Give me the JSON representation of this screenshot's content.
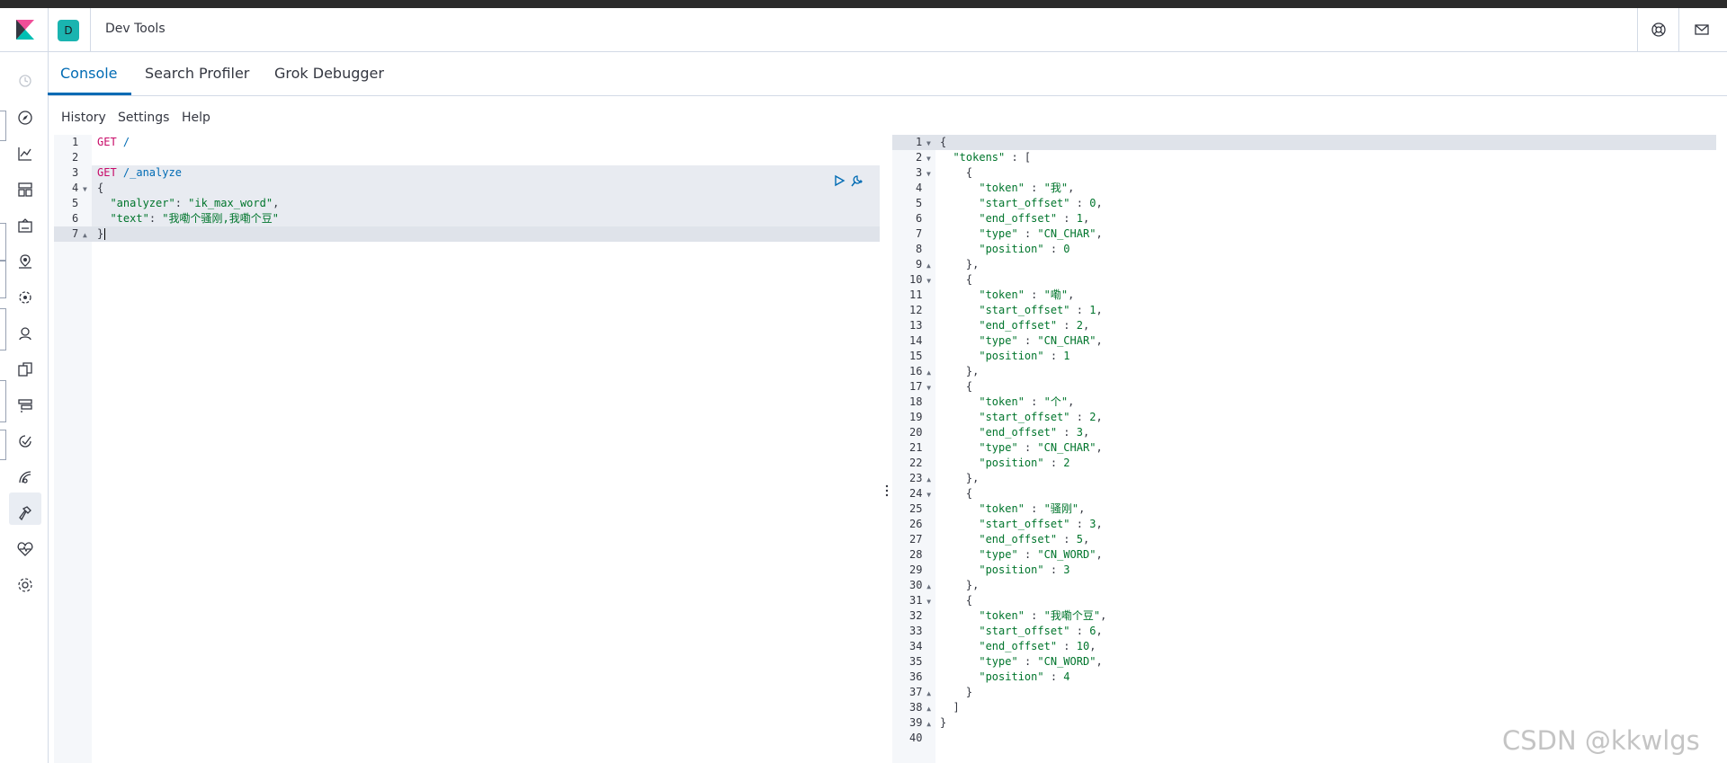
{
  "header": {
    "space_initial": "D",
    "title": "Dev Tools",
    "icons": [
      "help-icon",
      "mail-icon"
    ]
  },
  "tabs": [
    {
      "label": "Console",
      "active": true
    },
    {
      "label": "Search Profiler",
      "active": false
    },
    {
      "label": "Grok Debugger",
      "active": false
    }
  ],
  "console_menu": [
    "History",
    "Settings",
    "Help"
  ],
  "sidenav_icons": [
    "recent-icon",
    "discover-icon",
    "visualize-icon",
    "dashboard-icon",
    "canvas-icon",
    "maps-icon",
    "ml-icon",
    "graph-icon",
    "apm-icon",
    "uptime-icon",
    "metrics-icon",
    "siem-icon",
    "dev-tools-icon",
    "monitoring-icon",
    "management-icon"
  ],
  "request_editor": {
    "lines": [
      "GET /",
      "",
      "GET /_analyze",
      "{",
      "  \"analyzer\": \"ik_max_word\",",
      "  \"text\": \"我嘞个骚刚,我嘞个豆\"",
      "}"
    ]
  },
  "response_editor": {
    "lines": [
      "{",
      "  \"tokens\" : [",
      "    {",
      "      \"token\" : \"我\",",
      "      \"start_offset\" : 0,",
      "      \"end_offset\" : 1,",
      "      \"type\" : \"CN_CHAR\",",
      "      \"position\" : 0",
      "    },",
      "    {",
      "      \"token\" : \"嘞\",",
      "      \"start_offset\" : 1,",
      "      \"end_offset\" : 2,",
      "      \"type\" : \"CN_CHAR\",",
      "      \"position\" : 1",
      "    },",
      "    {",
      "      \"token\" : \"个\",",
      "      \"start_offset\" : 2,",
      "      \"end_offset\" : 3,",
      "      \"type\" : \"CN_CHAR\",",
      "      \"position\" : 2",
      "    },",
      "    {",
      "      \"token\" : \"骚刚\",",
      "      \"start_offset\" : 3,",
      "      \"end_offset\" : 5,",
      "      \"type\" : \"CN_WORD\",",
      "      \"position\" : 3",
      "    },",
      "    {",
      "      \"token\" : \"我嘞个豆\",",
      "      \"start_offset\" : 6,",
      "      \"end_offset\" : 10,",
      "      \"type\" : \"CN_WORD\",",
      "      \"position\" : 4",
      "    }",
      "  ]",
      "}",
      ""
    ]
  },
  "watermark": "CSDN @kkwlgs",
  "colors": {
    "accent": "#006bb4",
    "method": "#c80a68",
    "string": "#00752c",
    "space_badge": "#1ab4b0"
  }
}
